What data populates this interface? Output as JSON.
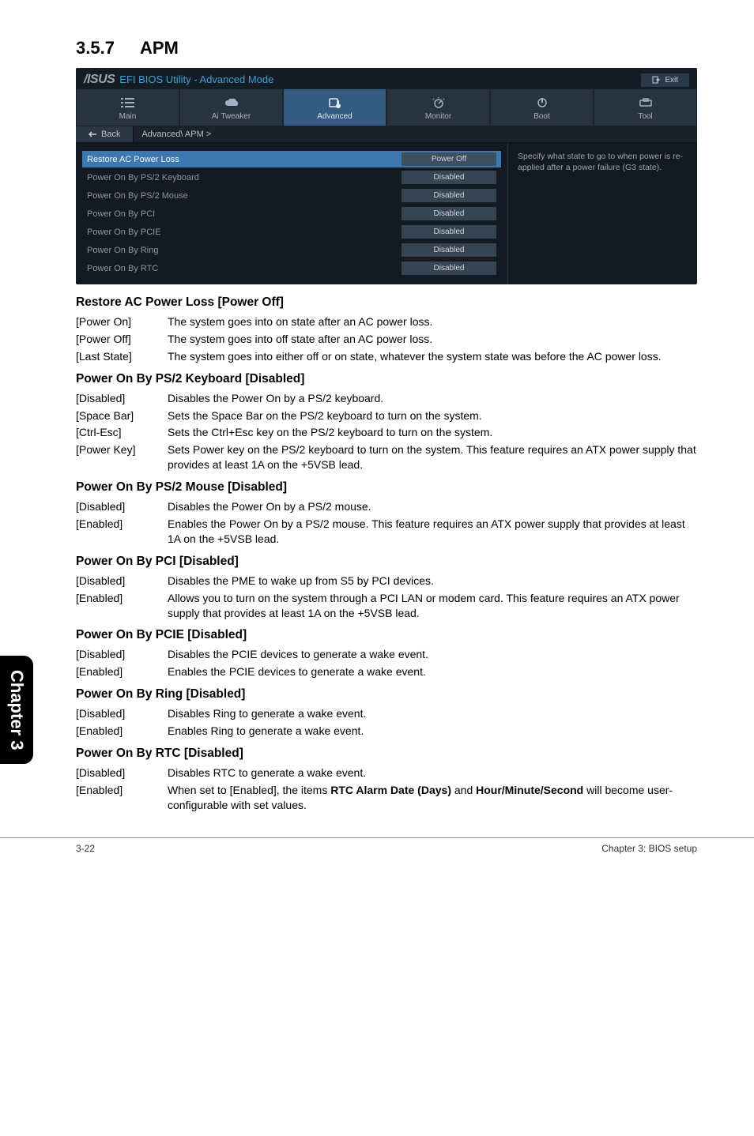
{
  "section": {
    "number": "3.5.7",
    "title": "APM"
  },
  "bios": {
    "title": "EFI BIOS Utility - Advanced Mode",
    "exit": "Exit",
    "tabs": {
      "main": "Main",
      "ai_tweaker": "Ai Tweaker",
      "advanced": "Advanced",
      "monitor": "Monitor",
      "boot": "Boot",
      "tool": "Tool"
    },
    "back": "Back",
    "breadcrumb": "Advanced\\ APM >",
    "rows": {
      "restore": {
        "name": "Restore AC Power Loss",
        "val": "Power Off"
      },
      "kb": {
        "name": "Power On By PS/2 Keyboard",
        "val": "Disabled"
      },
      "mouse": {
        "name": "Power On By PS/2 Mouse",
        "val": "Disabled"
      },
      "pci": {
        "name": "Power On By PCI",
        "val": "Disabled"
      },
      "pcie": {
        "name": "Power On By PCIE",
        "val": "Disabled"
      },
      "ring": {
        "name": "Power On By Ring",
        "val": "Disabled"
      },
      "rtc": {
        "name": "Power On By RTC",
        "val": "Disabled"
      }
    },
    "help": "Specify what state to go to when power is re-applied after a power failure (G3 state)."
  },
  "doc": {
    "s1": {
      "head": "Restore AC Power Loss [Power Off]",
      "o1": {
        "k": "[Power On]",
        "d": "The system goes into on state after an AC power loss."
      },
      "o2": {
        "k": "[Power Off]",
        "d": "The system goes into off state after an AC power loss."
      },
      "o3": {
        "k": "[Last State]",
        "d": "The system goes into either off or on state, whatever the system state was before the AC power loss."
      }
    },
    "s2": {
      "head": "Power On By PS/2 Keyboard [Disabled]",
      "o1": {
        "k": "[Disabled]",
        "d": "Disables the Power On by a PS/2 keyboard."
      },
      "o2": {
        "k": "[Space Bar]",
        "d": "Sets the Space Bar on the PS/2 keyboard to turn on the system."
      },
      "o3": {
        "k": "[Ctrl-Esc]",
        "d": "Sets the Ctrl+Esc key on the PS/2 keyboard to turn on the system."
      },
      "o4": {
        "k": "[Power Key]",
        "d": "Sets Power key on the PS/2 keyboard to turn on the system. This feature requires an ATX power supply that provides at least 1A on the +5VSB lead."
      }
    },
    "s3": {
      "head": "Power On By PS/2 Mouse [Disabled]",
      "o1": {
        "k": "[Disabled]",
        "d": "Disables the Power On by a PS/2 mouse."
      },
      "o2": {
        "k": "[Enabled]",
        "d": "Enables the Power On by a PS/2 mouse. This feature requires an ATX power supply that provides at least 1A on the +5VSB lead."
      }
    },
    "s4": {
      "head": "Power On By PCI [Disabled]",
      "o1": {
        "k": "[Disabled]",
        "d": "Disables the PME to wake up from S5 by PCI devices."
      },
      "o2": {
        "k": "[Enabled]",
        "d": "Allows you to turn on the system through a PCI LAN or modem card. This feature requires an ATX power supply that provides at least 1A on the +5VSB lead."
      }
    },
    "s5": {
      "head": "Power On By PCIE [Disabled]",
      "o1": {
        "k": "[Disabled]",
        "d": "Disables the PCIE devices to generate a wake event."
      },
      "o2": {
        "k": "[Enabled]",
        "d": "Enables the PCIE devices to generate a wake event."
      }
    },
    "s6": {
      "head": "Power On By Ring [Disabled]",
      "o1": {
        "k": "[Disabled]",
        "d": "Disables Ring to generate a wake event."
      },
      "o2": {
        "k": "[Enabled]",
        "d": "Enables Ring to generate a wake event."
      }
    },
    "s7": {
      "head": "Power On By RTC [Disabled]",
      "o1": {
        "k": "[Disabled]",
        "d": "Disables RTC to generate a wake event."
      },
      "o2k": "[Enabled]",
      "o2d_a": "When set to [Enabled], the items ",
      "o2d_b": "RTC Alarm Date (Days)",
      "o2d_c": " and ",
      "o2d_d": "Hour/Minute/Second",
      "o2d_e": " will become user-configurable with set values."
    }
  },
  "footer": {
    "left": "3-22",
    "right": "Chapter 3: BIOS setup"
  },
  "sidetab": "Chapter 3"
}
